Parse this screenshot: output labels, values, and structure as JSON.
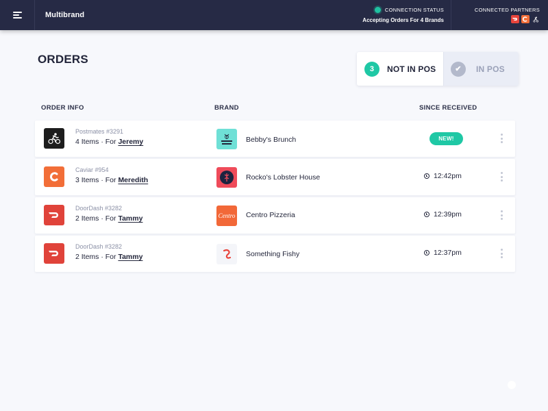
{
  "header": {
    "app_title": "Multibrand",
    "connection_status_label": "CONNECTION STATUS",
    "connection_status_value": "Accepting Orders For 4 Brands",
    "connected_partners_label": "CONNECTED PARTNERS",
    "partner_icons": [
      "doordash-icon",
      "caviar-icon",
      "postmates-icon"
    ],
    "status_color": "#1fc1a1"
  },
  "page": {
    "title": "ORDERS",
    "toggle": {
      "not_in_pos_count": "3",
      "not_in_pos_label": "NOT IN POS",
      "in_pos_label": "IN POS",
      "in_pos_icon": "✔"
    }
  },
  "table": {
    "columns": [
      "ORDER INFO",
      "BRAND",
      "SINCE RECEIVED"
    ],
    "rows": [
      {
        "partner": "Postmates #3291",
        "partner_icon": "postmates-icon",
        "items": "4 Items · For ",
        "customer": "Jeremy",
        "brand": "Bebby's Brunch",
        "brand_logo_text": "BEBBY'S\nBRUNCH",
        "status": "NEW!"
      },
      {
        "partner": "Caviar #954",
        "partner_icon": "caviar-icon",
        "items": "3 Items · For ",
        "customer": "Meredith",
        "brand": "Rocko's Lobster House",
        "time": "12:42pm"
      },
      {
        "partner": "DoorDash #3282",
        "partner_icon": "doordash-icon",
        "items": "2 Items · For ",
        "customer": "Tammy",
        "brand": "Centro Pizzeria",
        "brand_logo_text": "Centro",
        "time": "12:39pm"
      },
      {
        "partner": "DoorDash #3282",
        "partner_icon": "doordash-icon",
        "items": "2 Items · For ",
        "customer": "Tammy",
        "brand": "Something Fishy",
        "time": "12:37pm"
      }
    ]
  },
  "colors": {
    "topbar": "#262a45",
    "accent": "#1fc8a5",
    "doordash": "#e8453c",
    "caviar": "#f26e38",
    "postmates": "#1d1d1d"
  }
}
